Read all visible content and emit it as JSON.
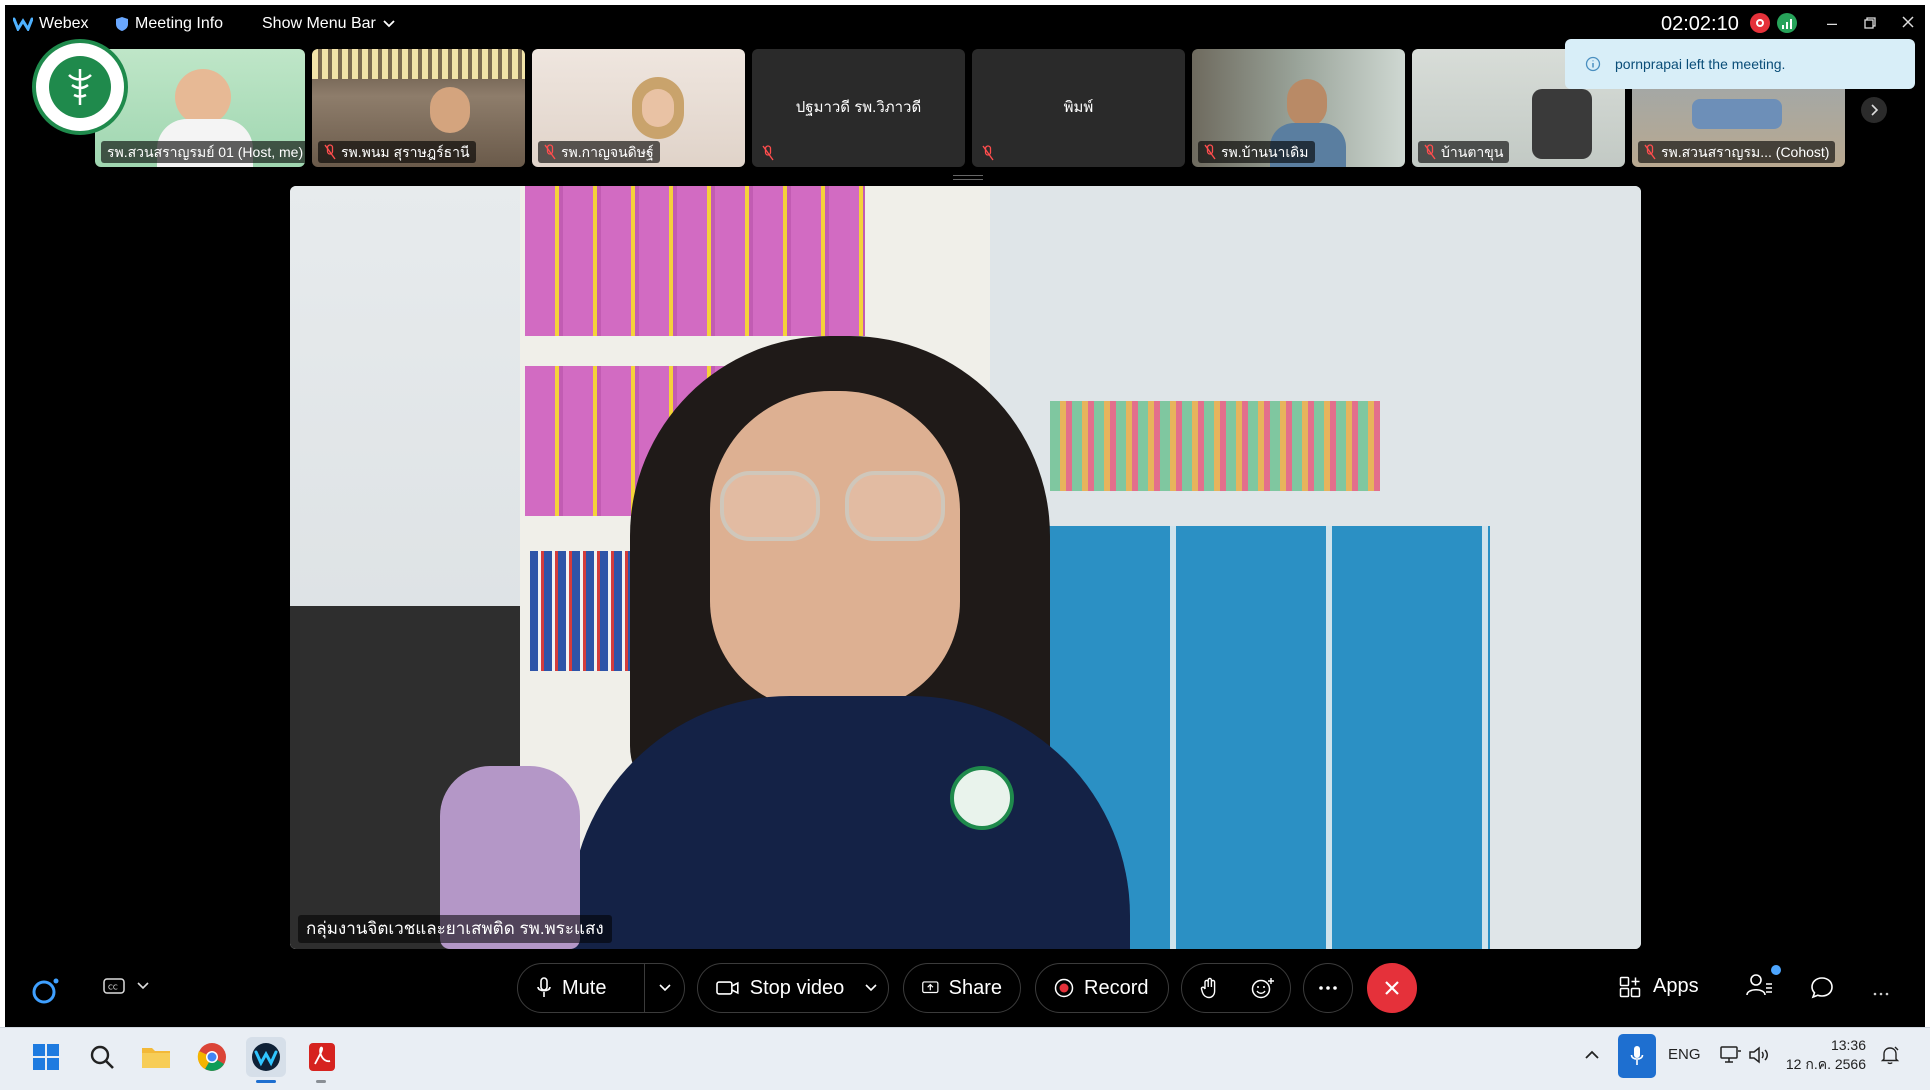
{
  "titlebar": {
    "app_name": "Webex",
    "meeting_info": "Meeting Info",
    "show_menu_bar": "Show Menu Bar",
    "timer": "02:02:10"
  },
  "participants": [
    {
      "name": "รพ.สวนสราญรมย์ 01 (Host, me)",
      "muted": false
    },
    {
      "name": "รพ.พนม สุราษฎร์ธานี",
      "muted": true
    },
    {
      "name": "รพ.กาญจนดิษฐ์",
      "muted": true
    },
    {
      "name": "ปฐมาวดี รพ.วิภาวดี",
      "muted": true
    },
    {
      "name": "พิมพ์",
      "muted": true
    },
    {
      "name": "รพ.บ้านนาเดิม",
      "muted": true
    },
    {
      "name": "บ้านตาขุน",
      "muted": true
    },
    {
      "name": "รพ.สวนสราญรม... (Cohost)",
      "muted": true
    }
  ],
  "toast": {
    "message": "pornprapai left the meeting."
  },
  "main_video": {
    "speaker": "กลุ่มงานจิตเวชและยาเสพติด รพ.พระแสง"
  },
  "controls": {
    "mute": "Mute",
    "stop_video": "Stop video",
    "share": "Share",
    "record": "Record",
    "apps": "Apps"
  },
  "taskbar": {
    "language": "ENG",
    "time": "13:36",
    "date": "12 ก.ค. 2566"
  },
  "colors": {
    "end_call": "#e5313a",
    "record_dot": "#e5313a",
    "toast_bg": "#d8eef8",
    "accent": "#2d6bd6"
  }
}
